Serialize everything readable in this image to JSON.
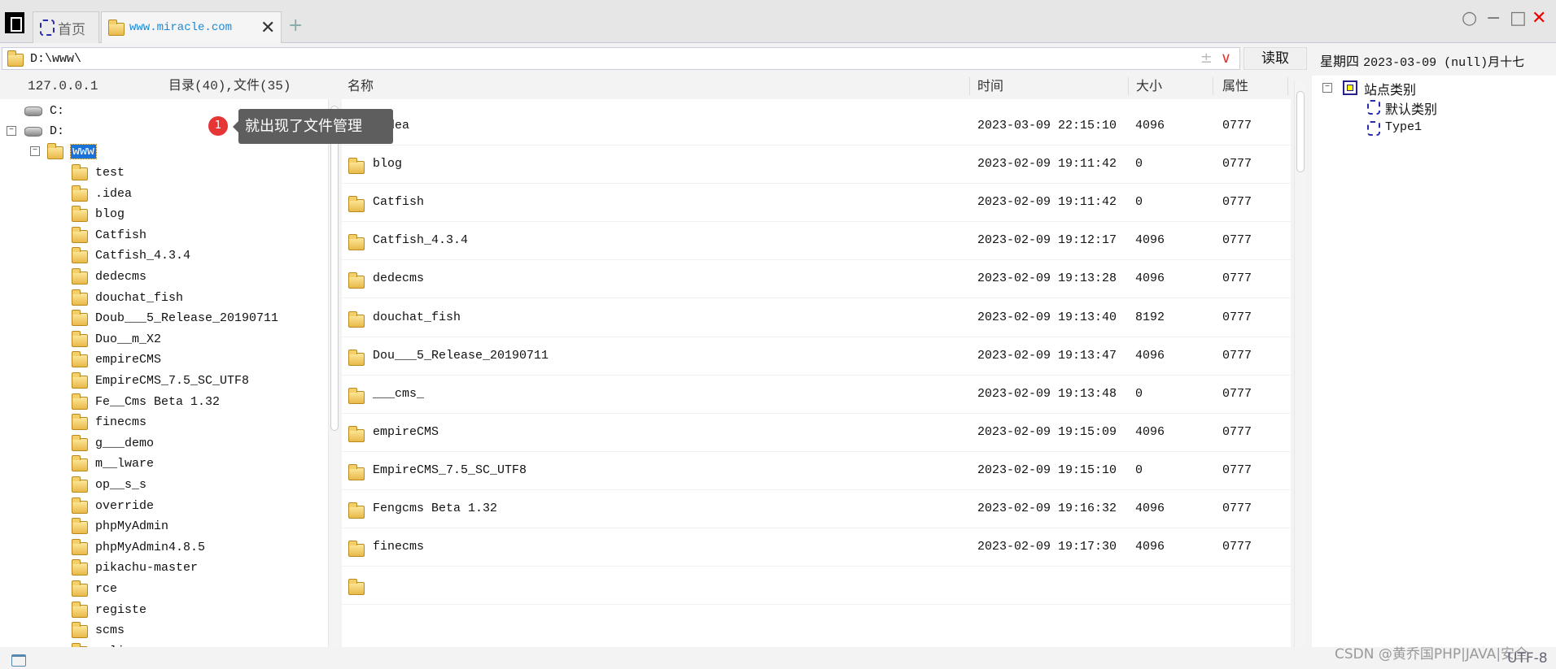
{
  "tabs": {
    "home_label": "首页",
    "active_label": "www.miracle.com",
    "add": "+",
    "close": "✕"
  },
  "window": {
    "pin": "○",
    "minimize": "−",
    "maximize": "□",
    "close": "✕"
  },
  "address": {
    "path": "D:\\www\\",
    "extra": "±",
    "dropdown": "∨",
    "read_label": "读取"
  },
  "date": {
    "weekday": "星期四",
    "value": "2023-03-09 (null)月十七"
  },
  "tree_header": {
    "host": "127.0.0.1",
    "summary": "目录(40),文件(35)"
  },
  "list_header": {
    "name": "名称",
    "time": "时间",
    "size": "大小",
    "attr": "属性"
  },
  "tree": {
    "drives": [
      "C:",
      "D:"
    ],
    "current": "www",
    "children": [
      "test",
      ".idea",
      "blog",
      "Catfish",
      "Catfish_4.3.4",
      "dedecms",
      "douchat_fish",
      "Doub___5_Release_20190711",
      "Duo__m_X2",
      "empireCMS",
      "EmpireCMS_7.5_SC_UTF8",
      "Fe__Cms Beta 1.32",
      "finecms",
      "g___demo",
      "m__lware",
      "op__s_s",
      "override",
      "phpMyAdmin",
      "phpMyAdmin4.8.5",
      "pikachu-master",
      "rce",
      "registe",
      "scms",
      "s_li"
    ]
  },
  "files": [
    {
      "name": ".idea",
      "time": "2023-03-09 22:15:10",
      "size": "4096",
      "attr": "0777"
    },
    {
      "name": "blog",
      "time": "2023-02-09 19:11:42",
      "size": "0",
      "attr": "0777"
    },
    {
      "name": "Catfish",
      "time": "2023-02-09 19:11:42",
      "size": "0",
      "attr": "0777"
    },
    {
      "name": "Catfish_4.3.4",
      "time": "2023-02-09 19:12:17",
      "size": "4096",
      "attr": "0777"
    },
    {
      "name": "dedecms",
      "time": "2023-02-09 19:13:28",
      "size": "4096",
      "attr": "0777"
    },
    {
      "name": "douchat_fish",
      "time": "2023-02-09 19:13:40",
      "size": "8192",
      "attr": "0777"
    },
    {
      "name": "Dou___5_Release_20190711",
      "time": "2023-02-09 19:13:47",
      "size": "4096",
      "attr": "0777"
    },
    {
      "name": "___cms_",
      "time": "2023-02-09 19:13:48",
      "size": "0",
      "attr": "0777"
    },
    {
      "name": "empireCMS",
      "time": "2023-02-09 19:15:09",
      "size": "4096",
      "attr": "0777"
    },
    {
      "name": "EmpireCMS_7.5_SC_UTF8",
      "time": "2023-02-09 19:15:10",
      "size": "0",
      "attr": "0777"
    },
    {
      "name": "Fengcms Beta 1.32",
      "time": "2023-02-09 19:16:32",
      "size": "4096",
      "attr": "0777"
    },
    {
      "name": "finecms",
      "time": "2023-02-09 19:17:30",
      "size": "4096",
      "attr": "0777"
    },
    {
      "name": "",
      "time": "",
      "size": "",
      "attr": ""
    }
  ],
  "site_tree": {
    "root": "站点类别",
    "items": [
      "默认类别",
      "Type1"
    ]
  },
  "tooltip": {
    "step": "1",
    "text": "就出现了文件管理"
  },
  "status": {
    "encoding": "UTF-8",
    "watermark": "CSDN @黄乔国PHP|JAVA|安全"
  }
}
